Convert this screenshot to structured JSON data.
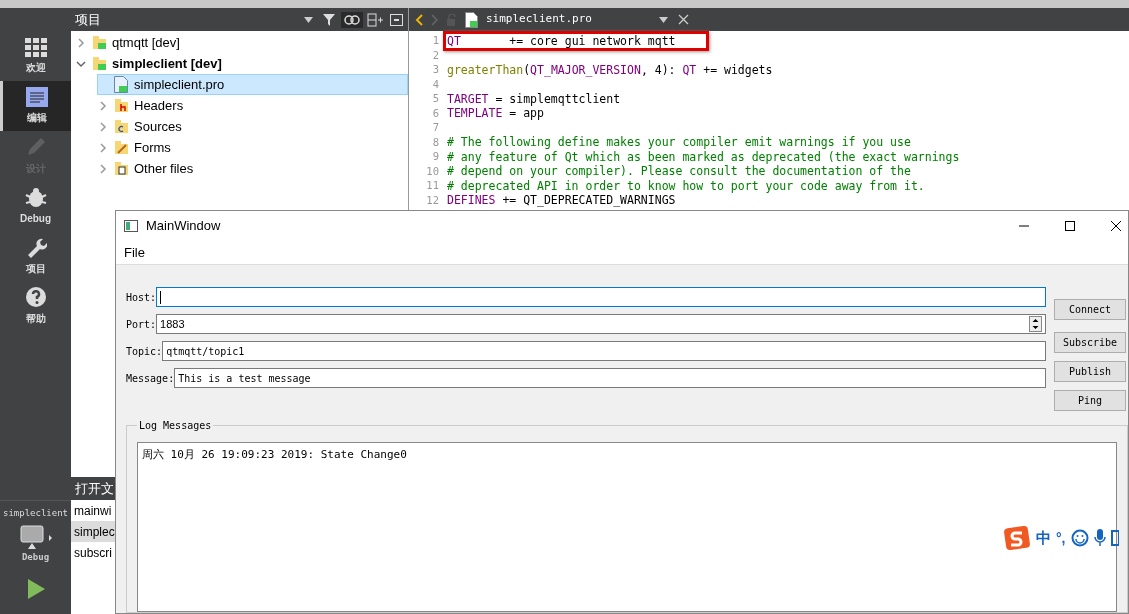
{
  "modes": [
    {
      "label": "欢迎",
      "kind": "grid",
      "selected": false,
      "disabled": false
    },
    {
      "label": "编辑",
      "kind": "doc",
      "selected": true,
      "disabled": false
    },
    {
      "label": "设计",
      "kind": "pencil",
      "selected": false,
      "disabled": true
    },
    {
      "label": "Debug",
      "kind": "bug",
      "selected": false,
      "disabled": false
    },
    {
      "label": "项目",
      "kind": "wrench",
      "selected": false,
      "disabled": false
    },
    {
      "label": "帮助",
      "kind": "help",
      "selected": false,
      "disabled": false
    }
  ],
  "kit": {
    "project": "simpleclient",
    "build": "Debug"
  },
  "project_panel": {
    "title": "项目",
    "tree": [
      {
        "label": "qtmqtt [dev]",
        "kind": "qtfolder",
        "bold": false,
        "expanded": false,
        "selected": false
      },
      {
        "label": "simpleclient [dev]",
        "kind": "qtfolder",
        "bold": true,
        "expanded": true,
        "selected": false,
        "children": [
          {
            "label": "simpleclient.pro",
            "kind": "profile",
            "selected": true
          },
          {
            "label": "Headers",
            "kind": "hfolder",
            "expanded": false,
            "selected": false
          },
          {
            "label": "Sources",
            "kind": "cppfolder",
            "expanded": false,
            "selected": false
          },
          {
            "label": "Forms",
            "kind": "formfolder",
            "expanded": false,
            "selected": false
          },
          {
            "label": "Other files",
            "kind": "otherfolder",
            "expanded": false,
            "selected": false
          }
        ]
      }
    ]
  },
  "open_documents": {
    "title": "打开文",
    "items": [
      {
        "label": "mainwi",
        "selected": false
      },
      {
        "label": "simplec",
        "selected": true
      },
      {
        "label": "subscri",
        "selected": false
      }
    ]
  },
  "editor": {
    "file": "simpleclient.pro",
    "lines": [
      {
        "number": "1",
        "highlighted": true,
        "segments": [
          {
            "text": "QT",
            "kind": "keyword"
          },
          {
            "text": "       += core gui network mqtt",
            "kind": "plain"
          }
        ]
      },
      {
        "number": "2",
        "highlighted": false
      },
      {
        "number": "3",
        "highlighted": false,
        "segments": [
          {
            "text": "greaterThan",
            "kind": "function"
          },
          {
            "text": "(",
            "kind": "plain"
          },
          {
            "text": "QT_MAJOR_VERSION",
            "kind": "keyword"
          },
          {
            "text": ", 4): ",
            "kind": "plain"
          },
          {
            "text": "QT",
            "kind": "keyword"
          },
          {
            "text": " += widgets",
            "kind": "plain"
          }
        ]
      },
      {
        "number": "4",
        "highlighted": false
      },
      {
        "number": "5",
        "highlighted": false,
        "segments": [
          {
            "text": "TARGET",
            "kind": "keyword"
          },
          {
            "text": " = simplemqttclient",
            "kind": "plain"
          }
        ]
      },
      {
        "number": "6",
        "highlighted": false,
        "segments": [
          {
            "text": "TEMPLATE",
            "kind": "keyword"
          },
          {
            "text": " = app",
            "kind": "plain"
          }
        ]
      },
      {
        "number": "7",
        "highlighted": false
      },
      {
        "number": "8",
        "highlighted": false,
        "segments": [
          {
            "text": "# The following define makes your compiler emit warnings if you use",
            "kind": "comment"
          }
        ]
      },
      {
        "number": "9",
        "highlighted": false,
        "segments": [
          {
            "text": "# any feature of Qt which as been marked as deprecated (the exact warnings",
            "kind": "comment"
          }
        ]
      },
      {
        "number": "10",
        "highlighted": false,
        "segments": [
          {
            "text": "# depend on your compiler). Please consult the documentation of the",
            "kind": "comment"
          }
        ]
      },
      {
        "number": "11",
        "highlighted": false,
        "segments": [
          {
            "text": "# deprecated API in order to know how to port your code away from it.",
            "kind": "comment"
          }
        ]
      },
      {
        "number": "12",
        "highlighted": false,
        "segments": [
          {
            "text": "DEFINES",
            "kind": "keyword"
          },
          {
            "text": " += QT_DEPRECATED_WARNINGS",
            "kind": "plain"
          }
        ]
      }
    ]
  },
  "main_window": {
    "title": "MainWindow",
    "menu": [
      "File"
    ],
    "host": {
      "label": "Host:"
    },
    "port": {
      "label": "Port:",
      "value": "1883"
    },
    "topic": {
      "label": "Topic:",
      "value": "qtmqtt/topic1"
    },
    "message": {
      "label": "Message:",
      "value": "This is a test message"
    },
    "buttons": {
      "connect": "Connect",
      "subscribe": "Subscribe",
      "publish": "Publish",
      "ping": "Ping"
    },
    "log": {
      "title": "Log Messages",
      "lines": [
        "周六 10月 26 19:09:23 2019: State Change0"
      ]
    }
  },
  "ime_toolbar": {
    "mode": "中",
    "punctuation": "°,"
  }
}
